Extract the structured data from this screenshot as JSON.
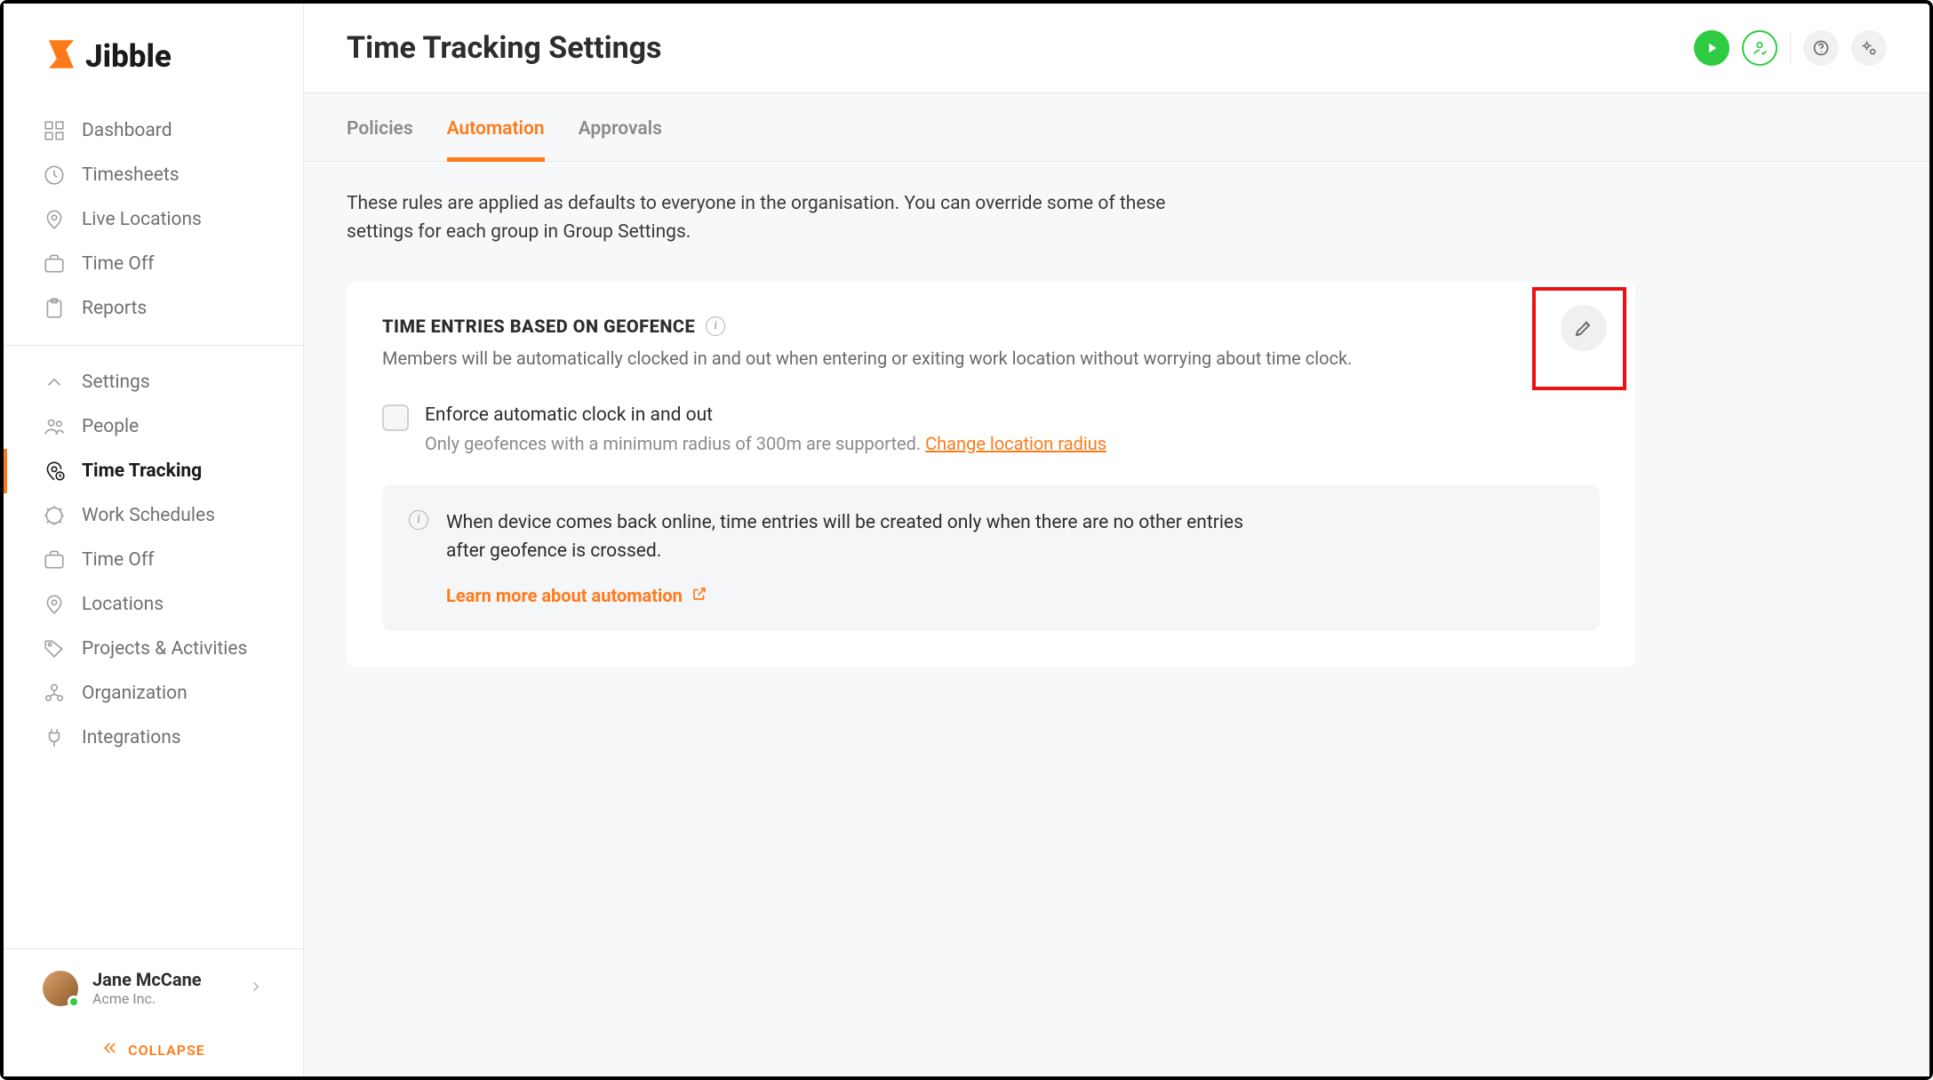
{
  "brand": {
    "name": "Jibble"
  },
  "sidebar": {
    "primary": [
      {
        "label": "Dashboard"
      },
      {
        "label": "Timesheets"
      },
      {
        "label": "Live Locations"
      },
      {
        "label": "Time Off"
      },
      {
        "label": "Reports"
      }
    ],
    "secondary": [
      {
        "label": "Settings"
      },
      {
        "label": "People"
      },
      {
        "label": "Time Tracking",
        "active": true
      },
      {
        "label": "Work Schedules"
      },
      {
        "label": "Time Off"
      },
      {
        "label": "Locations"
      },
      {
        "label": "Projects & Activities"
      },
      {
        "label": "Organization"
      },
      {
        "label": "Integrations"
      }
    ],
    "user": {
      "name": "Jane McCane",
      "org": "Acme Inc."
    },
    "collapse_label": "COLLAPSE"
  },
  "header": {
    "title": "Time Tracking Settings"
  },
  "tabs": [
    {
      "label": "Policies"
    },
    {
      "label": "Automation",
      "active": true
    },
    {
      "label": "Approvals"
    }
  ],
  "intro": "These rules are applied as defaults to everyone in the organisation. You can override some of these settings for each group in Group Settings.",
  "card": {
    "title": "TIME ENTRIES BASED ON GEOFENCE",
    "subtitle": "Members will be automatically clocked in and out when entering or exiting work location without worrying about time clock.",
    "checkbox_label": "Enforce automatic clock in and out",
    "checkbox_hint": "Only geofences with a minimum radius of 300m are supported. ",
    "checkbox_link": "Change location radius",
    "note_text": "When device comes back online, time entries will be created only when there are no other entries after geofence is crossed.",
    "note_link": "Learn more about automation"
  }
}
